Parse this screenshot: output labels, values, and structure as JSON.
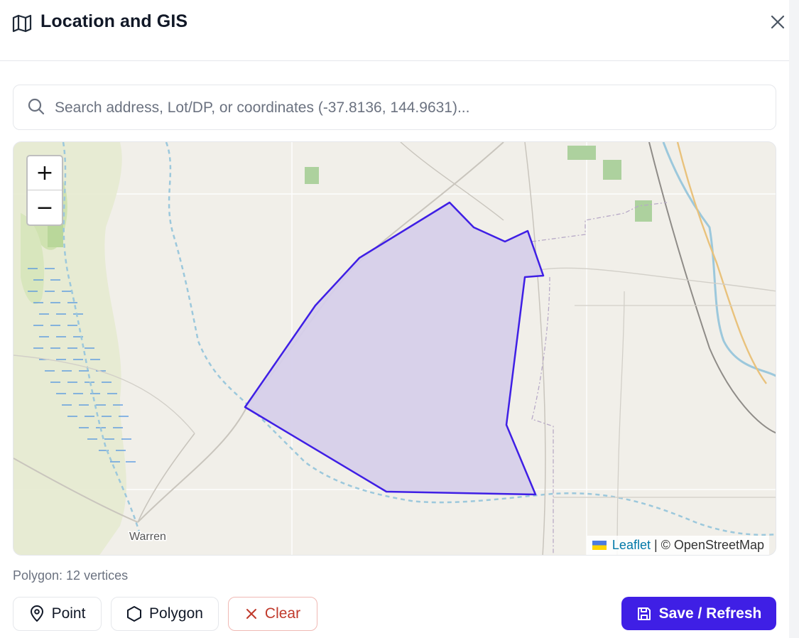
{
  "header": {
    "title": "Location and GIS",
    "icon": "map-icon",
    "close_icon": "close-icon"
  },
  "search": {
    "placeholder": "Search address, Lot/DP, or coordinates (-37.8136, 144.9631)...",
    "value": "",
    "icon": "search-icon"
  },
  "map": {
    "zoom_in_label": "+",
    "zoom_out_label": "−",
    "place_label": "Warren",
    "attribution": {
      "leaflet": "Leaflet",
      "separator": "|",
      "copyright": "© OpenStreetMap"
    },
    "polygon_stroke": "#3f1fe5",
    "polygon_fill": "#d6cfea"
  },
  "status": {
    "text": "Polygon: 12 vertices"
  },
  "actions": {
    "point_label": "Point",
    "polygon_label": "Polygon",
    "clear_label": "Clear",
    "save_label": "Save / Refresh"
  },
  "colors": {
    "primary": "#3f1fe5",
    "danger": "#c0392b",
    "border": "#e5e7eb",
    "muted_text": "#6b7280"
  }
}
